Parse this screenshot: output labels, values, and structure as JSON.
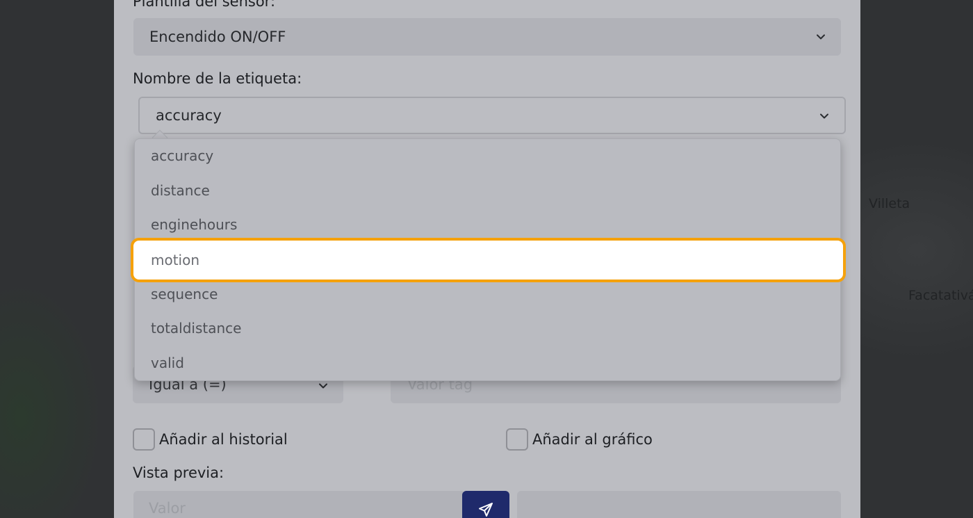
{
  "map": {
    "labels": [
      "Villeta",
      "Facatativá"
    ]
  },
  "form": {
    "template_label": "Plantilla del sensor:",
    "template_value": "Encendido ON/OFF",
    "tag_label": "Nombre de la etiqueta:",
    "tag_value": "accuracy",
    "condition_value": "Igual a (=)",
    "tag_value_placeholder": "Valor tag",
    "add_history_label": "Añadir al historial",
    "add_chart_label": "Añadir al gráfico",
    "preview_label": "Vista previa:",
    "preview_placeholder": "Valor"
  },
  "dropdown": {
    "options": [
      "accuracy",
      "distance",
      "enginehours",
      "motion",
      "sequence",
      "totaldistance",
      "valid"
    ],
    "highlighted": "motion"
  },
  "colors": {
    "accent_highlight": "#f5a10b",
    "send_button": "#1f2a6b"
  },
  "icons": {
    "chevron": "chevron-down-icon",
    "send": "paper-plane-icon"
  }
}
